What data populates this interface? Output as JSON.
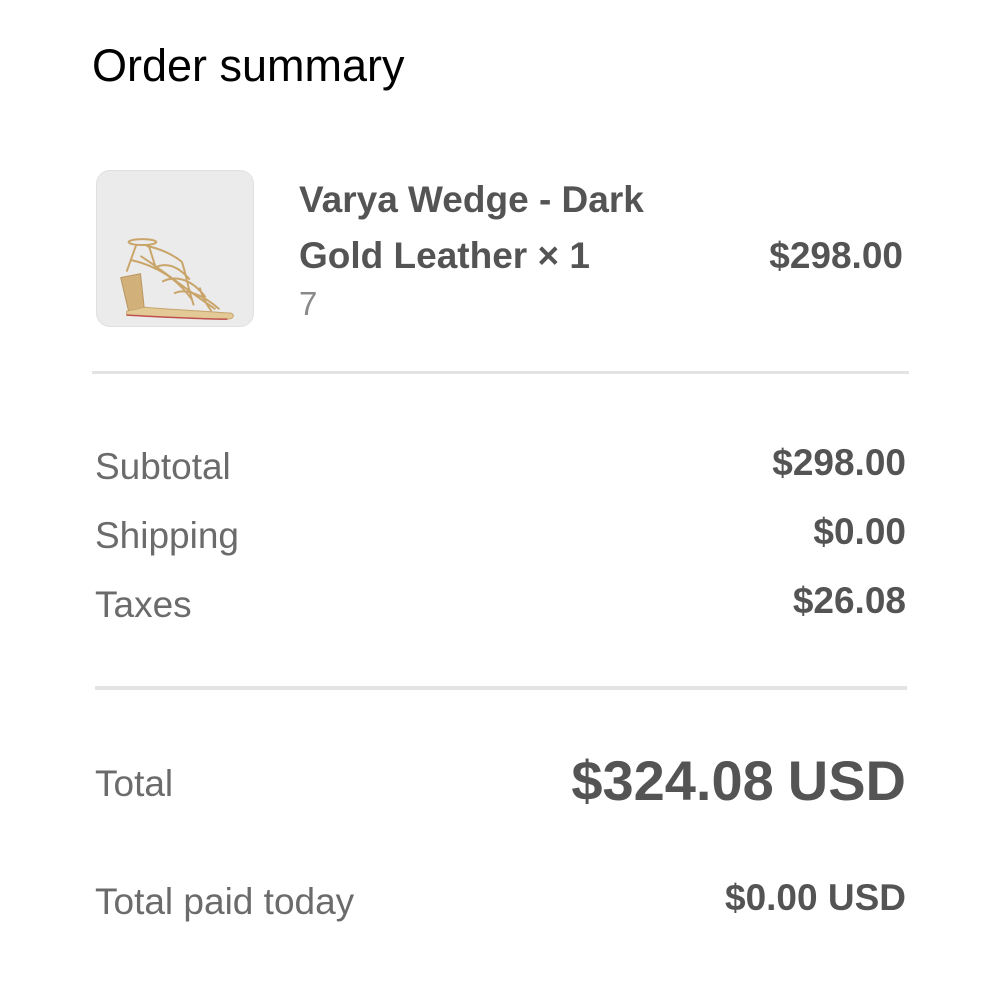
{
  "page": {
    "title": "Order summary"
  },
  "line_item": {
    "name": "Varya Wedge - Dark Gold Leather × 1",
    "variant": "7",
    "price": "$298.00",
    "image_icon": "sandal-product-image"
  },
  "totals": {
    "subtotal_label": "Subtotal",
    "subtotal_value": "$298.00",
    "shipping_label": "Shipping",
    "shipping_value": "$0.00",
    "taxes_label": "Taxes",
    "taxes_value": "$26.08",
    "total_label": "Total",
    "total_amount": "$324.08",
    "total_currency": "USD",
    "paid_today_label": "Total paid today",
    "paid_today_value": "$0.00 USD"
  },
  "colors": {
    "text_primary": "#000000",
    "text_strong": "#545454",
    "text_muted": "#6b6b6b",
    "divider": "#e3e3e3",
    "thumb_background": "#ebebeb"
  }
}
